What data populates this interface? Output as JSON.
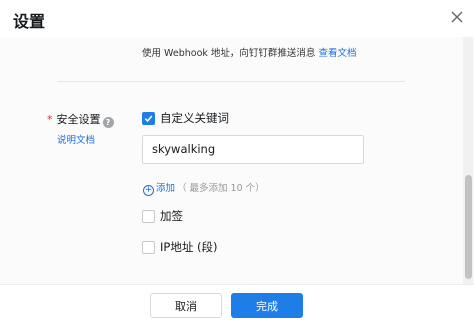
{
  "dialog": {
    "title": "设置"
  },
  "hint": {
    "text": "使用 Webhook 地址，向钉钉群推送消息",
    "link": "查看文档"
  },
  "security": {
    "label": "安全设置",
    "help": "?",
    "doc_link": "说明文档",
    "options": [
      {
        "label": "自定义关键词",
        "checked": true
      },
      {
        "label": "加签",
        "checked": false
      },
      {
        "label": "IP地址 (段)",
        "checked": false
      }
    ],
    "keyword_value": "skywalking",
    "add_label": "添加",
    "add_note": "（ 最多添加 10 个）"
  },
  "footer": {
    "cancel_label": "取消",
    "confirm_label": "完成"
  },
  "colors": {
    "accent": "#1f7de8",
    "required": "#f5222d"
  }
}
